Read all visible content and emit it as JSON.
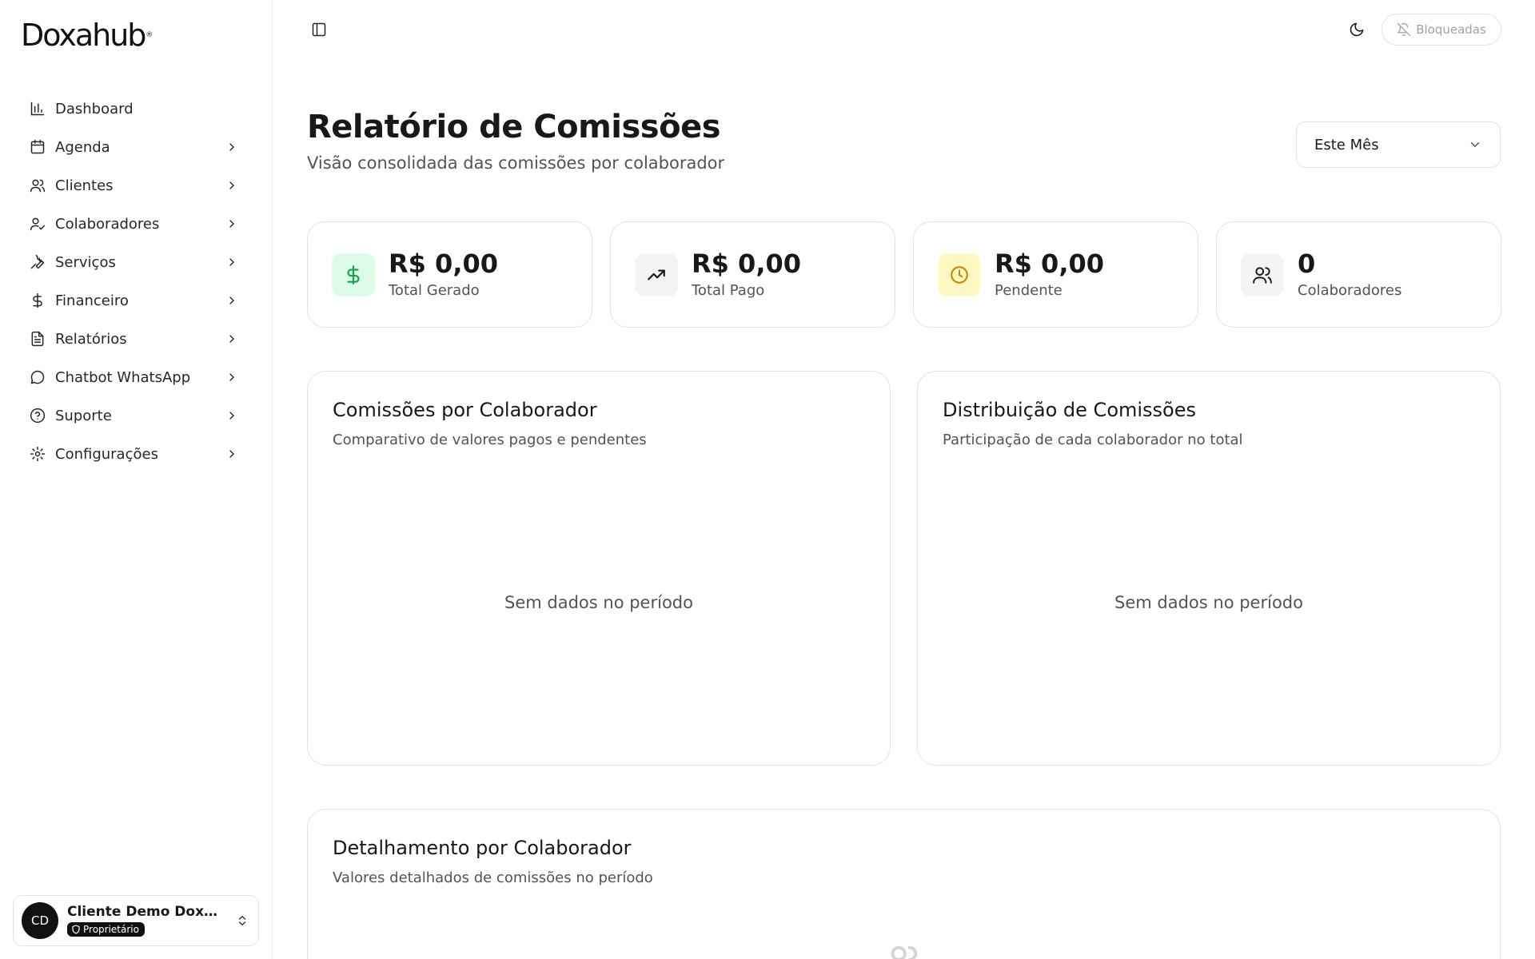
{
  "brand": {
    "logo_text": "Doxahub"
  },
  "sidebar": {
    "items": [
      {
        "label": "Dashboard",
        "icon": "bar-chart-icon",
        "has_chevron": false
      },
      {
        "label": "Agenda",
        "icon": "calendar-icon",
        "has_chevron": true
      },
      {
        "label": "Clientes",
        "icon": "users-icon",
        "has_chevron": true
      },
      {
        "label": "Colaboradores",
        "icon": "user-check-icon",
        "has_chevron": true
      },
      {
        "label": "Serviços",
        "icon": "wrench-icon",
        "has_chevron": true
      },
      {
        "label": "Financeiro",
        "icon": "dollar-icon",
        "has_chevron": true
      },
      {
        "label": "Relatórios",
        "icon": "file-text-icon",
        "has_chevron": true
      },
      {
        "label": "Chatbot WhatsApp",
        "icon": "chat-bubble-icon",
        "has_chevron": true
      },
      {
        "label": "Suporte",
        "icon": "help-circle-icon",
        "has_chevron": true
      },
      {
        "label": "Configurações",
        "icon": "gear-icon",
        "has_chevron": true
      }
    ],
    "user": {
      "initials": "CD",
      "name": "Cliente Demo Doxa...",
      "role": "Proprietário"
    }
  },
  "topbar": {
    "blocked_label": "Bloqueadas"
  },
  "page": {
    "title": "Relatório de Comissões",
    "subtitle": "Visão consolidada das comissões por colaborador",
    "period": "Este Mês"
  },
  "stats": [
    {
      "value": "R$ 0,00",
      "label": "Total Gerado",
      "icon": "dollar-icon",
      "icon_bg": "#dcfce7",
      "icon_color": "#16a34a"
    },
    {
      "value": "R$ 0,00",
      "label": "Total Pago",
      "icon": "trending-up-icon",
      "icon_bg": "#f4f4f5",
      "icon_color": "#18181b"
    },
    {
      "value": "R$ 0,00",
      "label": "Pendente",
      "icon": "clock-icon",
      "icon_bg": "#fef9c3",
      "icon_color": "#ca8a04"
    },
    {
      "value": "0",
      "label": "Colaboradores",
      "icon": "users-icon",
      "icon_bg": "#f4f4f5",
      "icon_color": "#18181b"
    }
  ],
  "panels": {
    "by_collaborator": {
      "title": "Comissões por Colaborador",
      "subtitle": "Comparativo de valores pagos e pendentes",
      "empty": "Sem dados no período"
    },
    "distribution": {
      "title": "Distribuição de Comissões",
      "subtitle": "Participação de cada colaborador no total",
      "empty": "Sem dados no período"
    },
    "detail": {
      "title": "Detalhamento por Colaborador",
      "subtitle": "Valores detalhados de comissões no período"
    }
  }
}
